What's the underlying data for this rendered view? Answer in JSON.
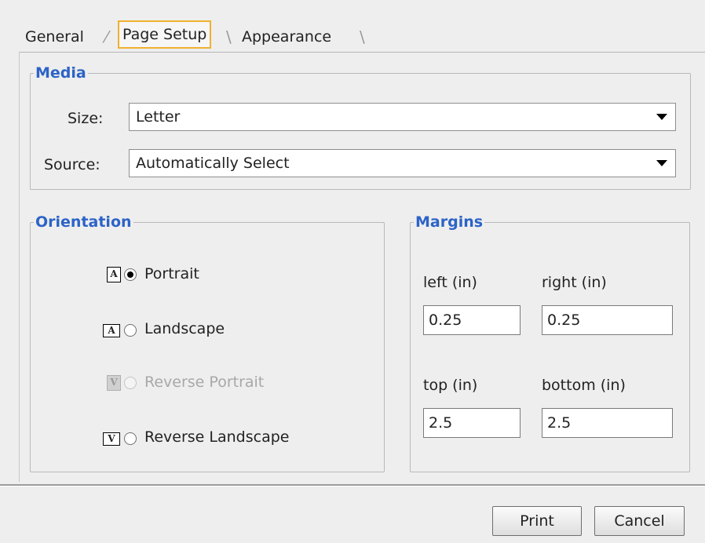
{
  "tabs": [
    {
      "label": "General",
      "mnemonic_index": 0
    },
    {
      "label": "Page Setup",
      "selected": true
    },
    {
      "label": "Appearance"
    }
  ],
  "media": {
    "title": "Media",
    "size_label": "Size:",
    "size_value": "Letter",
    "source_label": "Source:",
    "source_value": "Automatically Select"
  },
  "orientation": {
    "title": "Orientation",
    "options": [
      {
        "label": "Portrait",
        "selected": true,
        "enabled": true,
        "icon": "portrait-page-icon"
      },
      {
        "label": "Landscape",
        "selected": false,
        "enabled": true,
        "icon": "landscape-page-icon"
      },
      {
        "label": "Reverse Portrait",
        "selected": false,
        "enabled": false,
        "icon": "reverse-portrait-page-icon"
      },
      {
        "label": "Reverse Landscape",
        "selected": false,
        "enabled": true,
        "icon": "reverse-landscape-page-icon"
      }
    ]
  },
  "margins": {
    "title": "Margins",
    "left_label": "left (in)",
    "left_value": "0.25",
    "right_label": "right (in)",
    "right_value": "0.25",
    "top_label": "top (in)",
    "top_value": "2.5",
    "bottom_label": "bottom (in)",
    "bottom_value": "2.5"
  },
  "buttons": {
    "print": "Print",
    "cancel": "Cancel"
  },
  "colors": {
    "group_title": "#2c63c7",
    "selected_tab_border": "#f0b030",
    "background": "#eeeeee"
  }
}
